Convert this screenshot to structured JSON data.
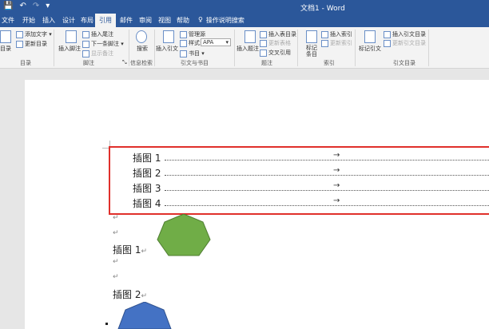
{
  "titlebar": {
    "qat": [
      "💾",
      "↶",
      "↷",
      "▾"
    ],
    "title": "文档1 - Word"
  },
  "tabs": [
    "文件",
    "开始",
    "插入",
    "设计",
    "布局",
    "引用",
    "邮件",
    "审阅",
    "视图",
    "帮助"
  ],
  "tell_me": "操作说明搜索",
  "ribbon": {
    "toc": {
      "big": "目录",
      "add_text": "添加文字 ▾",
      "update": "更新目录",
      "label": "目录"
    },
    "footnote": {
      "big": "插入脚注",
      "insert_endnote": "插入尾注",
      "next_footnote": "下一条脚注 ▾",
      "show_notes": "显示备注",
      "label": "脚注"
    },
    "research": {
      "big": "搜索",
      "label": "信息检索"
    },
    "citation": {
      "big": "插入引文",
      "manage": "管理源",
      "style_label": "样式:",
      "style_value": "APA",
      "bibliography": "书目 ▾",
      "label": "引文与书目"
    },
    "caption": {
      "big": "插入题注",
      "insert_tof": "插入表目录",
      "update_table": "更新表格",
      "cross_ref": "交叉引用",
      "label": "题注"
    },
    "index": {
      "big": "标记条目",
      "insert_index": "插入索引",
      "update_index": "更新索引",
      "label": "索引"
    },
    "toa": {
      "big": "标记引文",
      "insert_toa": "插入引文目录",
      "update_toa": "更新引文目录",
      "label": "引文目录"
    }
  },
  "document": {
    "toc_entries": [
      {
        "label": "插图 1",
        "arrow": "→"
      },
      {
        "label": "插图 2",
        "arrow": "→"
      },
      {
        "label": "插图 3",
        "arrow": "→"
      },
      {
        "label": "插图 4",
        "arrow": "→"
      }
    ],
    "para_mark": "↵",
    "captions": [
      {
        "text": "插图 1",
        "mark": "↵"
      },
      {
        "text": "插图 2",
        "mark": "↵"
      }
    ],
    "shape_colors": {
      "green": "#70ad47",
      "blue": "#4472c4"
    }
  }
}
